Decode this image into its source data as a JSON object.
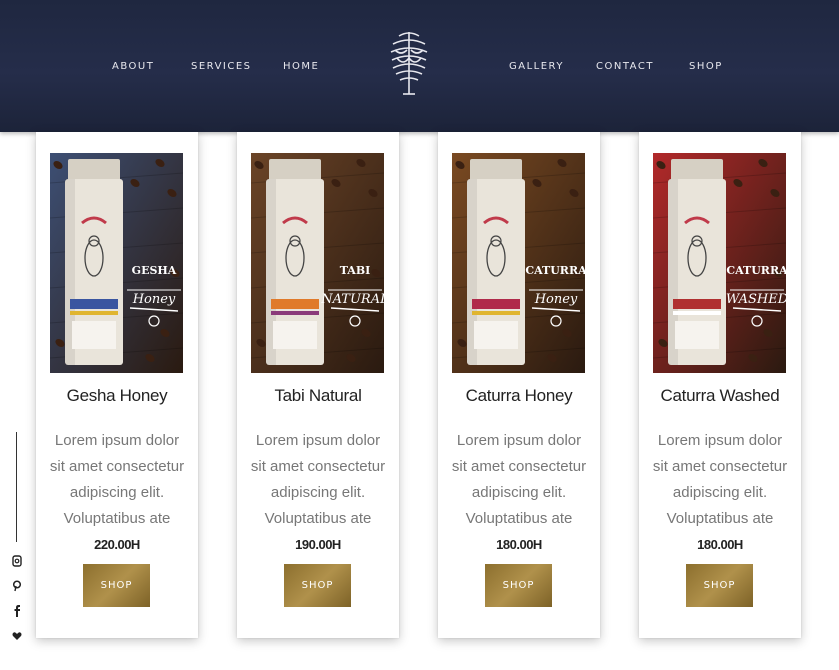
{
  "nav": {
    "left": [
      "ABOUT",
      "SERVICES",
      "HOME"
    ],
    "right": [
      "GALLERY",
      "CONTACT",
      "SHOP"
    ]
  },
  "brand_colors": {
    "header": "#232b45",
    "button_gold": "#9e8240",
    "text": "#222222",
    "muted": "#777777"
  },
  "products": [
    {
      "name": "Gesha Honey",
      "description": "Lorem ipsum dolor sit amet consectetur adipiscing elit. Voluptatibus ate",
      "price": "220.00H",
      "button": "SHOP",
      "badge_line1": "GESHA",
      "badge_line2": "Honey",
      "bg": "#3d4f74",
      "label_color": "#3a55a0",
      "label_accent": "#e0b530"
    },
    {
      "name": "Tabi Natural",
      "description": "Lorem ipsum dolor sit amet consectetur adipiscing elit. Voluptatibus ate",
      "price": "190.00H",
      "button": "SHOP",
      "badge_line1": "TABI",
      "badge_line2": "NATURAL",
      "bg": "#6b4427",
      "label_color": "#e07a2a",
      "label_accent": "#8a3a7a"
    },
    {
      "name": "Caturra Honey",
      "description": "Lorem ipsum dolor sit amet consectetur adipiscing elit. Voluptatibus ate",
      "price": "180.00H",
      "button": "SHOP",
      "badge_line1": "CATURRA",
      "badge_line2": "Honey",
      "bg": "#7a4a22",
      "label_color": "#b02a4a",
      "label_accent": "#e0b530"
    },
    {
      "name": "Caturra Washed",
      "description": "Lorem ipsum dolor sit amet consectetur adipiscing elit. Voluptatibus ate",
      "price": "180.00H",
      "button": "SHOP",
      "badge_line1": "CATURRA",
      "badge_line2": "WASHED",
      "bg": "#b2292a",
      "label_color": "#b03030",
      "label_accent": "#ffffff"
    }
  ],
  "social_icons": [
    "instagram-icon",
    "pinterest-icon",
    "facebook-icon",
    "heart-icon"
  ]
}
